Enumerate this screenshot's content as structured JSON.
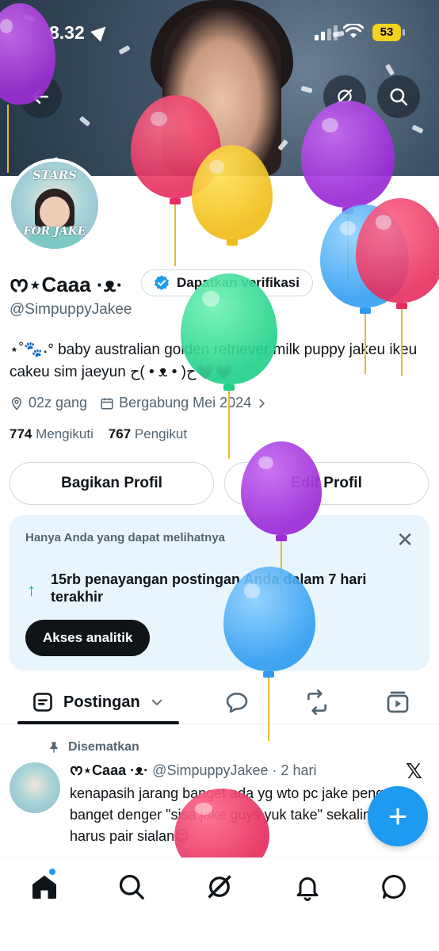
{
  "status_bar": {
    "time": "8.32",
    "battery": "53"
  },
  "profile": {
    "name": "ᰔ⋆Caaa ·ᴥ·",
    "verify_label": "Dapatkan verifikasi",
    "handle": "@SimpuppyJakee",
    "bio": "⋆˚🐾˖° baby australian golden retriever milk puppy jakeu ikeu cakeu sim jaeyun ح( • ᴥ • )ح💗💗",
    "location": "02z gang",
    "joined": "Bergabung Mei 2024",
    "following_count": "774",
    "following_label": "Mengikuti",
    "followers_count": "767",
    "followers_label": "Pengikut",
    "avatar_text_top": "STARS",
    "avatar_text_bottom": "FOR JAKE"
  },
  "buttons": {
    "share": "Bagikan Profil",
    "edit": "Edit Profil"
  },
  "analytics_card": {
    "header": "Hanya Anda yang dapat melihatnya",
    "views_text": "15rb penayangan postingan Anda dalam 7 hari terakhir",
    "button": "Akses analitik"
  },
  "tabs": {
    "active": "Postingan"
  },
  "pinned_post": {
    "pinned_label": "Disematkan",
    "author": "ᰔ⋆Caaa ·ᴥ·",
    "handle_time": "@SimpuppyJakee · 2 hari",
    "text": "kenapasih jarang banget ada yg wto pc jake pengen banget denger \"sisa jake guys yuk take\" sekalinya ada harus pair sialan😌"
  },
  "icons": [
    "back-arrow-icon",
    "grok-icon",
    "search-icon",
    "verified-badge-icon",
    "location-icon",
    "calendar-icon",
    "chevron-right-icon",
    "close-icon",
    "arrow-up-icon",
    "posts-tab-icon",
    "reply-icon",
    "repost-icon",
    "media-icon",
    "pin-icon",
    "x-logo-icon",
    "plus-icon",
    "home-icon",
    "notification-icon",
    "messages-icon"
  ],
  "colors": {
    "accent": "#1d9bf0",
    "analytics_bg": "#e8f5fd",
    "growth": "#00ba7c"
  }
}
